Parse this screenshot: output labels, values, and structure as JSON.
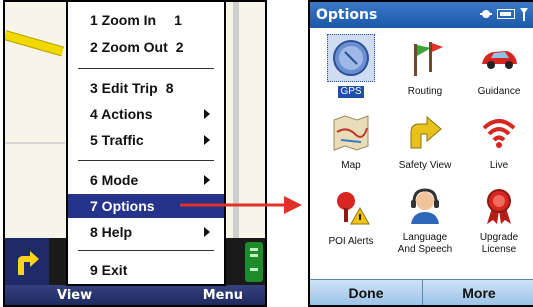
{
  "left_screen": {
    "menu": {
      "items": [
        {
          "label": "1 Zoom In",
          "shortcut": "1",
          "submenu": false
        },
        {
          "label": "2 Zoom Out",
          "shortcut": "2",
          "submenu": false
        },
        {
          "label": "3 Edit Trip",
          "shortcut": "8",
          "submenu": false
        },
        {
          "label": "4 Actions",
          "shortcut": "",
          "submenu": true
        },
        {
          "label": "5 Traffic",
          "shortcut": "",
          "submenu": true
        },
        {
          "label": "6 Mode",
          "shortcut": "",
          "submenu": true
        },
        {
          "label": "7 Options",
          "shortcut": "",
          "submenu": false,
          "selected": true
        },
        {
          "label": "8 Help",
          "shortcut": "",
          "submenu": true
        },
        {
          "label": "9 Exit",
          "shortcut": "",
          "submenu": false
        }
      ]
    },
    "softkeys": {
      "left": "View",
      "right": "Menu"
    },
    "turn_icon": "turn-right-arrow-icon"
  },
  "right_screen": {
    "title": "Options",
    "status_icons": [
      "connectivity-icon",
      "battery-icon",
      "signal-icon"
    ],
    "grid": [
      {
        "label": "GPS",
        "icon": "gps-compass-icon",
        "selected": true
      },
      {
        "label": "Routing",
        "icon": "routing-flags-icon",
        "selected": false
      },
      {
        "label": "Guidance",
        "icon": "guidance-car-icon",
        "selected": false
      },
      {
        "label": "Map",
        "icon": "map-icon",
        "selected": false
      },
      {
        "label": "Safety View",
        "icon": "safety-view-arrow-icon",
        "selected": false
      },
      {
        "label": "Live",
        "icon": "live-signal-icon",
        "selected": false
      },
      {
        "label": "POI Alerts",
        "icon": "poi-alerts-icon",
        "selected": false
      },
      {
        "label": "Language\nAnd Speech",
        "icon": "language-speech-headset-icon",
        "selected": false
      },
      {
        "label": "Upgrade\nLicense",
        "icon": "upgrade-license-ribbon-icon",
        "selected": false
      }
    ],
    "softkeys": {
      "left": "Done",
      "right": "More"
    }
  },
  "colors": {
    "menu_selected": "#25338a",
    "title_bar": "#2a68b8",
    "arrow": "#e0312b",
    "softkey_bar": "#b5d3ef"
  }
}
